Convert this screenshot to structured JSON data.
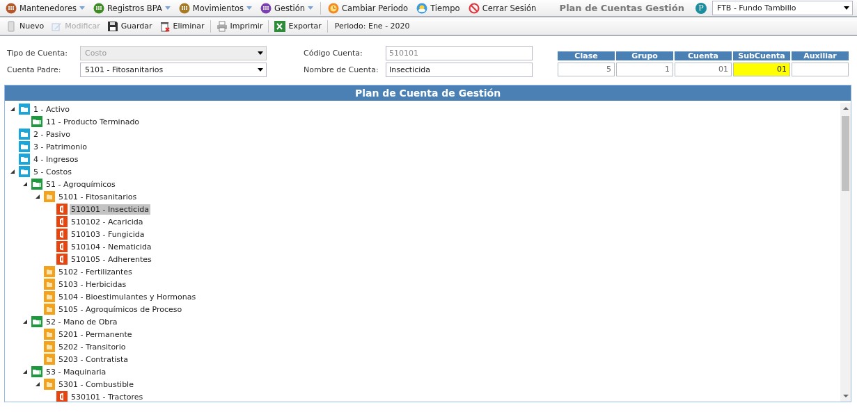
{
  "menu": [
    {
      "label": "Mantenedores",
      "kind": "grid",
      "color": "#b5562c",
      "has_menu": true
    },
    {
      "label": "Registros BPA",
      "kind": "grid",
      "color": "#3f8a24",
      "has_menu": true
    },
    {
      "label": "Movimientos",
      "kind": "grid",
      "color": "#a87a25",
      "has_menu": true
    },
    {
      "label": "Gestión",
      "kind": "grid",
      "color": "#7b3fb0",
      "has_menu": true
    },
    {
      "label": "Cambiar Periodo",
      "kind": "clock",
      "color": "#f08a24",
      "has_menu": false
    },
    {
      "label": "Tiempo",
      "kind": "weather",
      "color": "#3a9be0",
      "has_menu": false
    },
    {
      "label": "Cerrar Sesión",
      "kind": "stop",
      "color": "#e0383e",
      "has_menu": false
    }
  ],
  "page_title": "Plan de Cuentas Gestión",
  "company": {
    "badge": "P",
    "value": "FTB - Fundo Tambillo"
  },
  "toolbar": [
    {
      "label": "Nuevo",
      "kind": "new",
      "disabled": false
    },
    {
      "label": "Modificar",
      "kind": "edit",
      "disabled": true
    },
    {
      "label": "Guardar",
      "kind": "save",
      "disabled": false
    },
    {
      "label": "Eliminar",
      "kind": "delete",
      "disabled": false
    },
    {
      "label": "Imprimir",
      "kind": "print",
      "disabled": false
    },
    {
      "label": "Exportar",
      "kind": "export",
      "disabled": false
    }
  ],
  "period": "Periodo: Ene - 2020",
  "form": {
    "tipo_cuenta": {
      "label": "Tipo de Cuenta:",
      "value": "Costo",
      "disabled": true
    },
    "cuenta_padre": {
      "label": "Cuenta Padre:",
      "value": "5101 - Fitosanitarios",
      "disabled": false
    },
    "codigo_cuenta": {
      "label": "Código Cuenta:",
      "value": "510101",
      "disabled": true
    },
    "nombre_cuenta": {
      "label": "Nombre de Cuenta:",
      "value": "Insecticida",
      "disabled": false
    }
  },
  "code_parts": [
    {
      "header": "Clase",
      "value": "5",
      "selected": false
    },
    {
      "header": "Grupo",
      "value": "1",
      "selected": false
    },
    {
      "header": "Cuenta",
      "value": "01",
      "selected": false
    },
    {
      "header": "SubCuenta",
      "value": "01",
      "selected": true
    },
    {
      "header": "Auxiliar",
      "selected": false
    }
  ],
  "tree": {
    "title": "Plan de Cuenta de Gestión",
    "items": [
      {
        "label": "1 - Activo",
        "kind": "clase",
        "expanded": true,
        "selected": false,
        "children": [
          {
            "label": "11 - Producto Terminado",
            "kind": "grupo",
            "selected": false
          }
        ]
      },
      {
        "label": "2 - Pasivo",
        "kind": "clase",
        "selected": false
      },
      {
        "label": "3 - Patrimonio",
        "kind": "clase",
        "selected": false
      },
      {
        "label": "4 - Ingresos",
        "kind": "clase",
        "selected": false
      },
      {
        "label": "5 - Costos",
        "kind": "clase",
        "expanded": true,
        "selected": false,
        "children": [
          {
            "label": "51 - Agroquímicos",
            "kind": "grupo",
            "expanded": true,
            "selected": false,
            "children": [
              {
                "label": "5101 - Fitosanitarios",
                "kind": "cuenta",
                "expanded": true,
                "selected": false,
                "children": [
                  {
                    "label": "510101 - Insecticida",
                    "kind": "subcuenta",
                    "selected": true
                  },
                  {
                    "label": "510102 - Acaricida",
                    "kind": "subcuenta",
                    "selected": false
                  },
                  {
                    "label": "510103 - Fungicida",
                    "kind": "subcuenta",
                    "selected": false
                  },
                  {
                    "label": "510104 - Nematicida",
                    "kind": "subcuenta",
                    "selected": false
                  },
                  {
                    "label": "510105 - Adherentes",
                    "kind": "subcuenta",
                    "selected": false
                  }
                ]
              },
              {
                "label": "5102 - Fertilizantes",
                "kind": "cuenta",
                "selected": false
              },
              {
                "label": "5103 - Herbicidas",
                "kind": "cuenta",
                "selected": false
              },
              {
                "label": "5104 - Bioestimulantes y Hormonas",
                "kind": "cuenta",
                "selected": false
              },
              {
                "label": "5105 - Agroquímicos de Proceso",
                "kind": "cuenta",
                "selected": false
              }
            ]
          },
          {
            "label": "52 - Mano de Obra",
            "kind": "grupo",
            "expanded": true,
            "selected": false,
            "children": [
              {
                "label": "5201 - Permanente",
                "kind": "cuenta",
                "selected": false
              },
              {
                "label": "5202 - Transitorio",
                "kind": "cuenta",
                "selected": false
              },
              {
                "label": "5203 - Contratista",
                "kind": "cuenta",
                "selected": false
              }
            ]
          },
          {
            "label": "53 - Maquinaria",
            "kind": "grupo",
            "expanded": true,
            "selected": false,
            "children": [
              {
                "label": "5301 - Combustible",
                "kind": "cuenta",
                "expanded": true,
                "selected": false,
                "children": [
                  {
                    "label": "530101 - Tractores",
                    "kind": "subcuenta",
                    "selected": false
                  }
                ]
              }
            ]
          }
        ]
      }
    ]
  }
}
